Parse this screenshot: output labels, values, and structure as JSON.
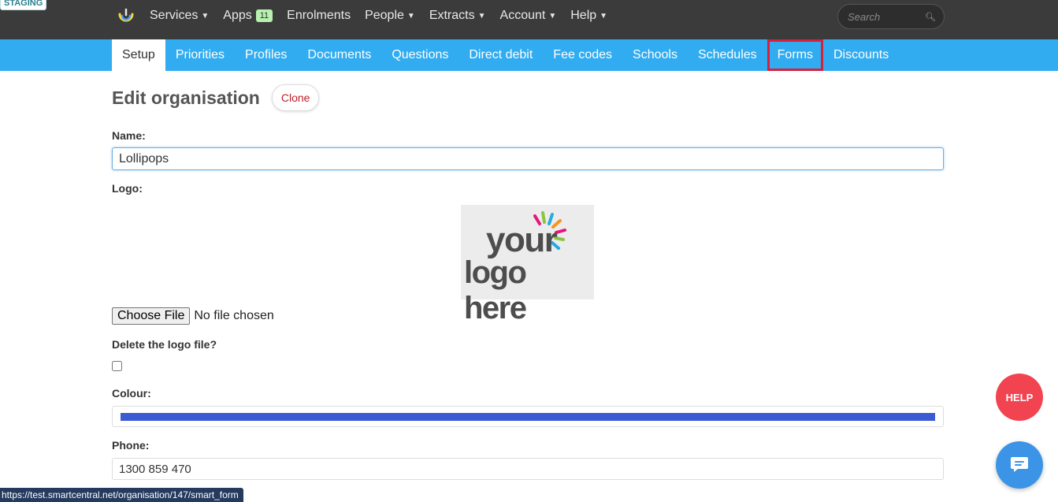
{
  "env_badge": "STAGING",
  "topnav": {
    "items": [
      {
        "label": "Services",
        "caret": true
      },
      {
        "label": "Apps",
        "badge": "11"
      },
      {
        "label": "Enrolments"
      },
      {
        "label": "People",
        "caret": true
      },
      {
        "label": "Extracts",
        "caret": true
      },
      {
        "label": "Account",
        "caret": true
      },
      {
        "label": "Help",
        "caret": true
      }
    ],
    "search_placeholder": "Search"
  },
  "subnav": {
    "items": [
      "Setup",
      "Priorities",
      "Profiles",
      "Documents",
      "Questions",
      "Direct debit",
      "Fee codes",
      "Schools",
      "Schedules",
      "Forms",
      "Discounts"
    ],
    "active": "Setup",
    "highlighted": "Forms"
  },
  "page": {
    "title": "Edit organisation",
    "clone_label": "Clone"
  },
  "form": {
    "name_label": "Name:",
    "name_value": "Lollipops",
    "logo_label": "Logo:",
    "logo_text_line1": "your",
    "logo_text_line2": "logo here",
    "file_button": "Choose File",
    "file_status": "No file chosen",
    "delete_label": "Delete the logo file?",
    "delete_checked": false,
    "colour_label": "Colour:",
    "colour_value": "#3b5bd2",
    "phone_label": "Phone:",
    "phone_value": "1300 859 470"
  },
  "help_button": "HELP",
  "status_url": "https://test.smartcentral.net/organisation/147/smart_form",
  "colors": {
    "topbar": "#3b3b3b",
    "subbar": "#31acf0",
    "highlight": "#d81f3b",
    "help": "#f24450",
    "chat": "#3b94e6"
  }
}
